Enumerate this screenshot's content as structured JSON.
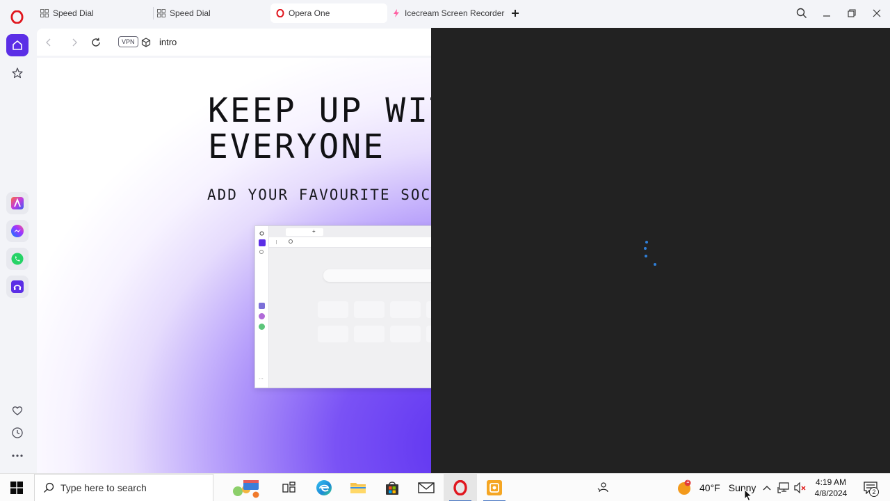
{
  "sidebar": {
    "top_icons": [
      "opera-logo",
      "home-icon",
      "star-icon"
    ],
    "apps": [
      "aria-icon",
      "messenger-icon",
      "whatsapp-icon",
      "music-player-icon"
    ],
    "bottom_icons": [
      "heart-icon",
      "history-icon",
      "more-icon"
    ]
  },
  "tabs": [
    {
      "label": "Speed Dial",
      "icon": "speed-dial-icon",
      "active": false
    },
    {
      "label": "Speed Dial",
      "icon": "speed-dial-icon",
      "active": false
    },
    {
      "label": "Opera One",
      "icon": "opera-icon",
      "active": true
    },
    {
      "label": "Icecream Screen Recorder",
      "icon": "icecream-icon",
      "active": false
    }
  ],
  "addressbar": {
    "vpn_label": "VPN",
    "url": "intro"
  },
  "page": {
    "title": "KEEP UP WITH\nEVERYONE",
    "subtitle": "ADD YOUR FAVOURITE SOCIAL"
  },
  "taskbar": {
    "search_placeholder": "Type here to search",
    "weather_temp": "40°F",
    "weather_condition": "Sunny",
    "weather_badge": "1",
    "time": "4:19 AM",
    "date": "4/8/2024",
    "notification_count": "2"
  },
  "colors": {
    "accent": "#5b2ee6",
    "opera_red": "#e0161e",
    "dark_panel": "#222222",
    "spinner": "#2f7fd8"
  }
}
